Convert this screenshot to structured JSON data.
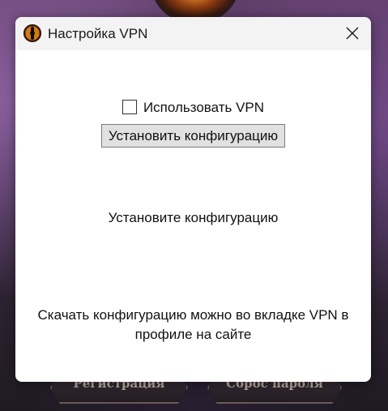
{
  "background": {
    "left_button_label": "Регистрация",
    "right_button_label": "Сброс пароля"
  },
  "dialog": {
    "title": "Настройка VPN",
    "icon": "app-eye-icon",
    "close_icon": "close-icon",
    "use_vpn_label": "Использовать VPN",
    "use_vpn_checked": false,
    "install_config_button": "Установить конфигурацию",
    "status_text": "Установите конфигурацию",
    "info_line1": "Скачать конфигурацию можно во вкладке VPN в",
    "info_line2": "профиле на сайте"
  },
  "colors": {
    "dialog_background": "#ffffff",
    "titlebar_background": "#f3f3f3",
    "button_background": "#e1e1e1"
  }
}
